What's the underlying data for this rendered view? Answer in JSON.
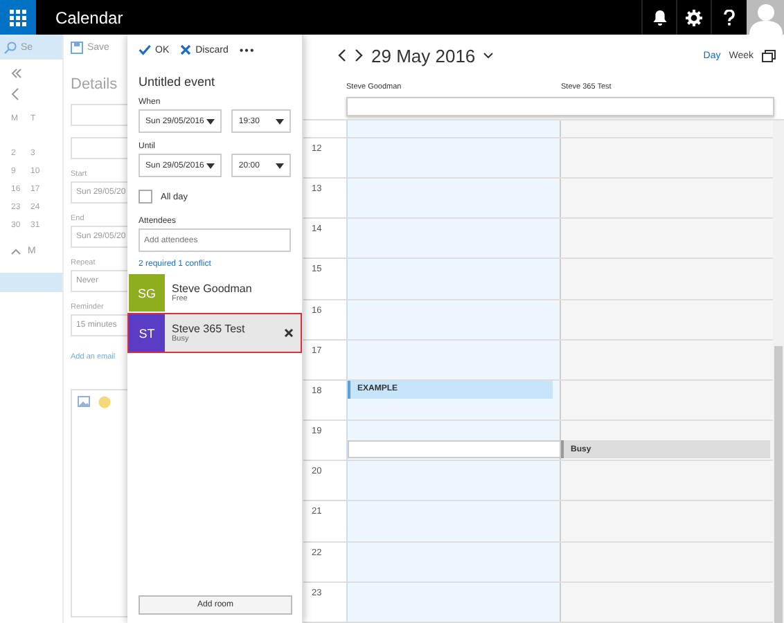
{
  "top_bar": {
    "title": "Calendar"
  },
  "background": {
    "search": "Se",
    "save": "Save",
    "weekdays": [
      "M",
      "T"
    ],
    "weeks": [
      [
        "2",
        "3"
      ],
      [
        "9",
        "10"
      ],
      [
        "16",
        "17"
      ],
      [
        "23",
        "24"
      ],
      [
        "30",
        "31"
      ]
    ],
    "group": "M",
    "details_title": "Details",
    "fields": [
      {
        "label": "Start",
        "value": "Sun 29/05/20"
      },
      {
        "label": "End",
        "value": "Sun 29/05/20"
      },
      {
        "label": "Repeat",
        "value": "Never"
      },
      {
        "label": "Reminder",
        "value": "15 minutes"
      }
    ],
    "email_link": "Add an email"
  },
  "event_panel": {
    "ok": "OK",
    "discard": "Discard",
    "more": "•••",
    "title": "Untitled event",
    "when": {
      "label": "When",
      "date": "Sun 29/05/2016",
      "time": "19:30"
    },
    "until": {
      "label": "Until",
      "date": "Sun 29/05/2016",
      "time": "20:00"
    },
    "all_day": {
      "label": "All day",
      "checked": false
    },
    "attendees": {
      "label": "Attendees",
      "placeholder": "Add attendees"
    },
    "conflict": "2 required 1 conflict",
    "people": [
      {
        "initials": "SG",
        "name": "Steve Goodman",
        "status": "Free",
        "color": "#8fae1f",
        "selected": false
      },
      {
        "initials": "ST",
        "name": "Steve 365 Test",
        "status": "Busy",
        "color": "#5b3cc4",
        "selected": true
      }
    ],
    "add_room": "Add room"
  },
  "calendar": {
    "date": "29 May 2016",
    "views": [
      {
        "label": "Day",
        "selected": true
      },
      {
        "label": "Week",
        "selected": false
      }
    ],
    "columns": [
      "Steve Goodman",
      "Steve 365 Test"
    ],
    "hours": [
      {
        "label": "12"
      },
      {
        "label": "13"
      },
      {
        "label": "14"
      },
      {
        "label": "15"
      },
      {
        "label": "16"
      },
      {
        "label": "17"
      },
      {
        "label": "18",
        "left": {
          "top": {
            "kind": "appointment",
            "title": "EXAMPLE"
          }
        }
      },
      {
        "label": "19",
        "left": {
          "bottom": {
            "kind": "new-slot"
          }
        },
        "right": {
          "bottom": {
            "kind": "busy",
            "title": "Busy"
          }
        }
      },
      {
        "label": "20"
      },
      {
        "label": "21"
      },
      {
        "label": "22"
      },
      {
        "label": "23"
      }
    ]
  }
}
